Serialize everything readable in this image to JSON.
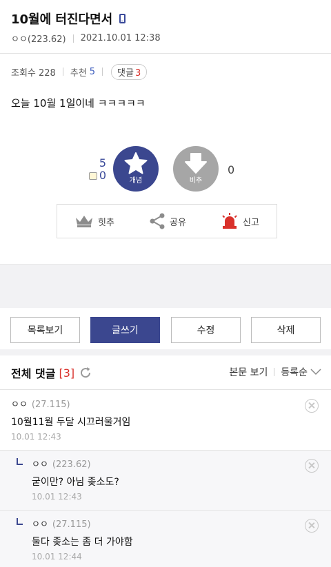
{
  "post": {
    "title": "10월에 터진다면서",
    "author": "ㅇㅇ(223.62)",
    "datetime": "2021.10.01 12:38",
    "body": "오늘 10월 1일이네 ㅋㅋㅋㅋㅋ"
  },
  "stats": {
    "views_label": "조회수 228",
    "recommend_label": "추천",
    "recommend_value": "5",
    "comments_label": "댓글",
    "comments_value": "3"
  },
  "vote": {
    "up_count": "5",
    "fixed_count": "0",
    "up_label": "개념",
    "down_label": "비추",
    "down_count": "0"
  },
  "actions": {
    "hit_label": "힛추",
    "share_label": "공유",
    "report_label": "신고"
  },
  "buttons": {
    "list": "목록보기",
    "write": "글쓰기",
    "edit": "수정",
    "delete": "삭제"
  },
  "comments_header": {
    "title": "전체 댓글",
    "count": "[3]",
    "view_body": "본문 보기",
    "sort": "등록순"
  },
  "comments": [
    {
      "author": "ㅇㅇ",
      "ip": "(27.115)",
      "text": "10월11월 두달 시끄러울거임",
      "date": "10.01 12:43"
    },
    {
      "author": "ㅇㅇ",
      "ip": "(223.62)",
      "text": "굳이만? 아님 좆소도?",
      "date": "10.01 12:43"
    },
    {
      "author": "ㅇㅇ",
      "ip": "(27.115)",
      "text": "둘다 좆소는 좀 더 가야함",
      "date": "10.01 12:44"
    }
  ],
  "colors": {
    "brand": "#3b478f",
    "accent_red": "#d9312b",
    "accent_blue": "#3b5bbd",
    "down_gray": "#a6a6a6"
  },
  "icons": {
    "title": "mobile-phone-icon",
    "vote_up": "star-icon",
    "vote_down": "down-arrow-icon",
    "hit": "crown-icon",
    "share": "share-icon",
    "report": "siren-icon",
    "refresh": "refresh-icon",
    "sort": "chevron-down-icon",
    "delete": "close-circle-icon",
    "reply": "reply-arrow-icon"
  }
}
